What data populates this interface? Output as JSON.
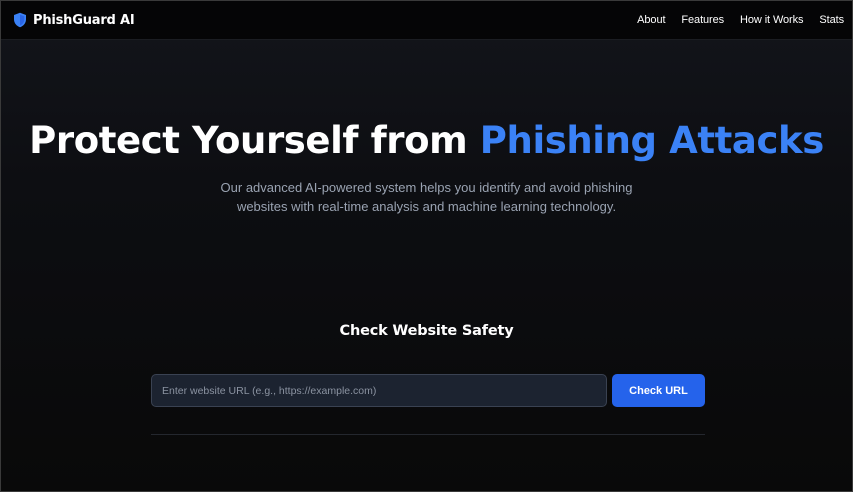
{
  "brand": {
    "name": "PhishGuard AI",
    "icon": "shield-icon",
    "icon_color": "#3b82f6"
  },
  "nav": {
    "items": [
      {
        "label": "About"
      },
      {
        "label": "Features"
      },
      {
        "label": "How it Works"
      },
      {
        "label": "Stats"
      }
    ]
  },
  "hero": {
    "title_main": "Protect Yourself from ",
    "title_accent": "Phishing Attacks",
    "accent_color": "#3b82f6",
    "subtitle_line1": "Our advanced AI-powered system helps you identify and avoid phishing",
    "subtitle_line2": "websites with real-time analysis and machine learning technology."
  },
  "checker": {
    "title": "Check Website Safety",
    "input_value": "",
    "input_placeholder": "Enter website URL (e.g., https://example.com)",
    "button_label": "Check URL",
    "button_color": "#2563eb"
  }
}
